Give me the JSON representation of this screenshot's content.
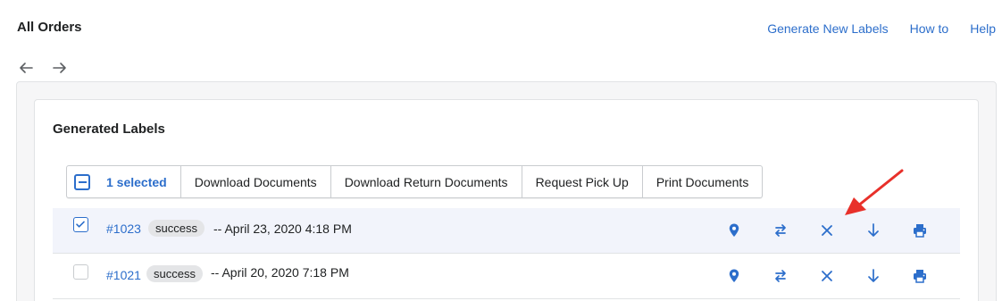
{
  "header": {
    "title": "All Orders",
    "links": [
      "Generate New Labels",
      "How to",
      "Help"
    ]
  },
  "nav": {
    "back_icon": "arrow-left-icon",
    "forward_icon": "arrow-right-icon"
  },
  "section": {
    "title": "Generated Labels"
  },
  "bulk_actions": {
    "selected_label": "1 selected",
    "buttons": [
      "Download Documents",
      "Download Return Documents",
      "Request Pick Up",
      "Print Documents"
    ]
  },
  "orders": [
    {
      "number": "#1023",
      "status": "success",
      "date": "-- April 23, 2020 4:18 PM",
      "checked": true
    },
    {
      "number": "#1021",
      "status": "success",
      "date": "-- April 20, 2020 7:18 PM",
      "checked": false
    }
  ],
  "row_actions": [
    "location-pin-icon",
    "return-arrow-icon",
    "close-icon",
    "arrow-down-icon",
    "printer-icon"
  ],
  "colors": {
    "accent": "#2c6ecb",
    "annotation": "#e8302a",
    "selected_row": "#f2f4fb"
  }
}
